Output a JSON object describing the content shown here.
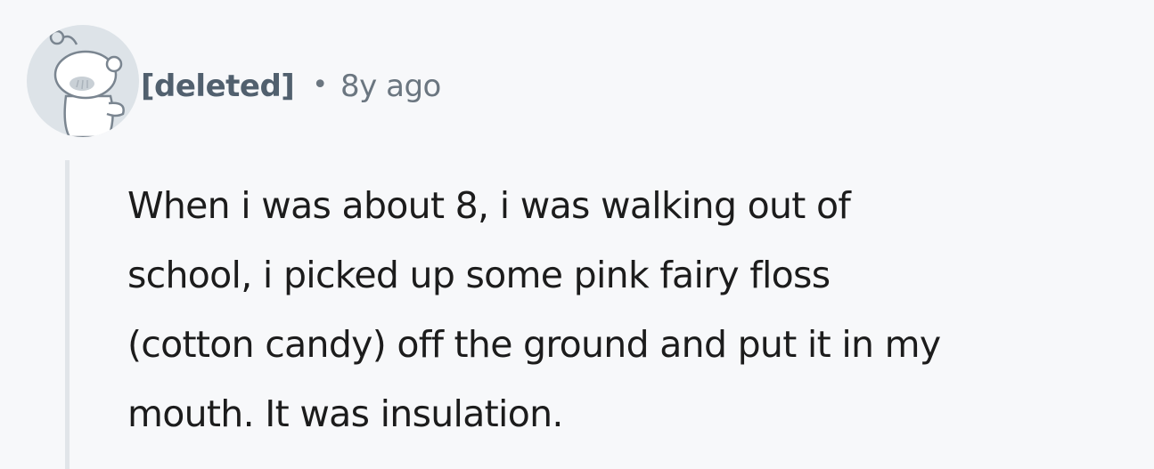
{
  "comment": {
    "author": "[deleted]",
    "separator": "•",
    "age": "8y ago",
    "avatar_icon": "snoo-avatar-icon",
    "body_lines": [
      "When i was about 8, i was walking out of",
      "school, i picked up some pink fairy floss",
      "(cotton candy) off the ground and put it in my",
      "mouth. It was insulation."
    ]
  },
  "colors": {
    "background": "#f7f8fa",
    "author": "#51606e",
    "meta": "#6b7680",
    "body": "#1c1c1c",
    "thread_line": "#e1e5e9",
    "avatar_bg": "#dde3e8"
  }
}
